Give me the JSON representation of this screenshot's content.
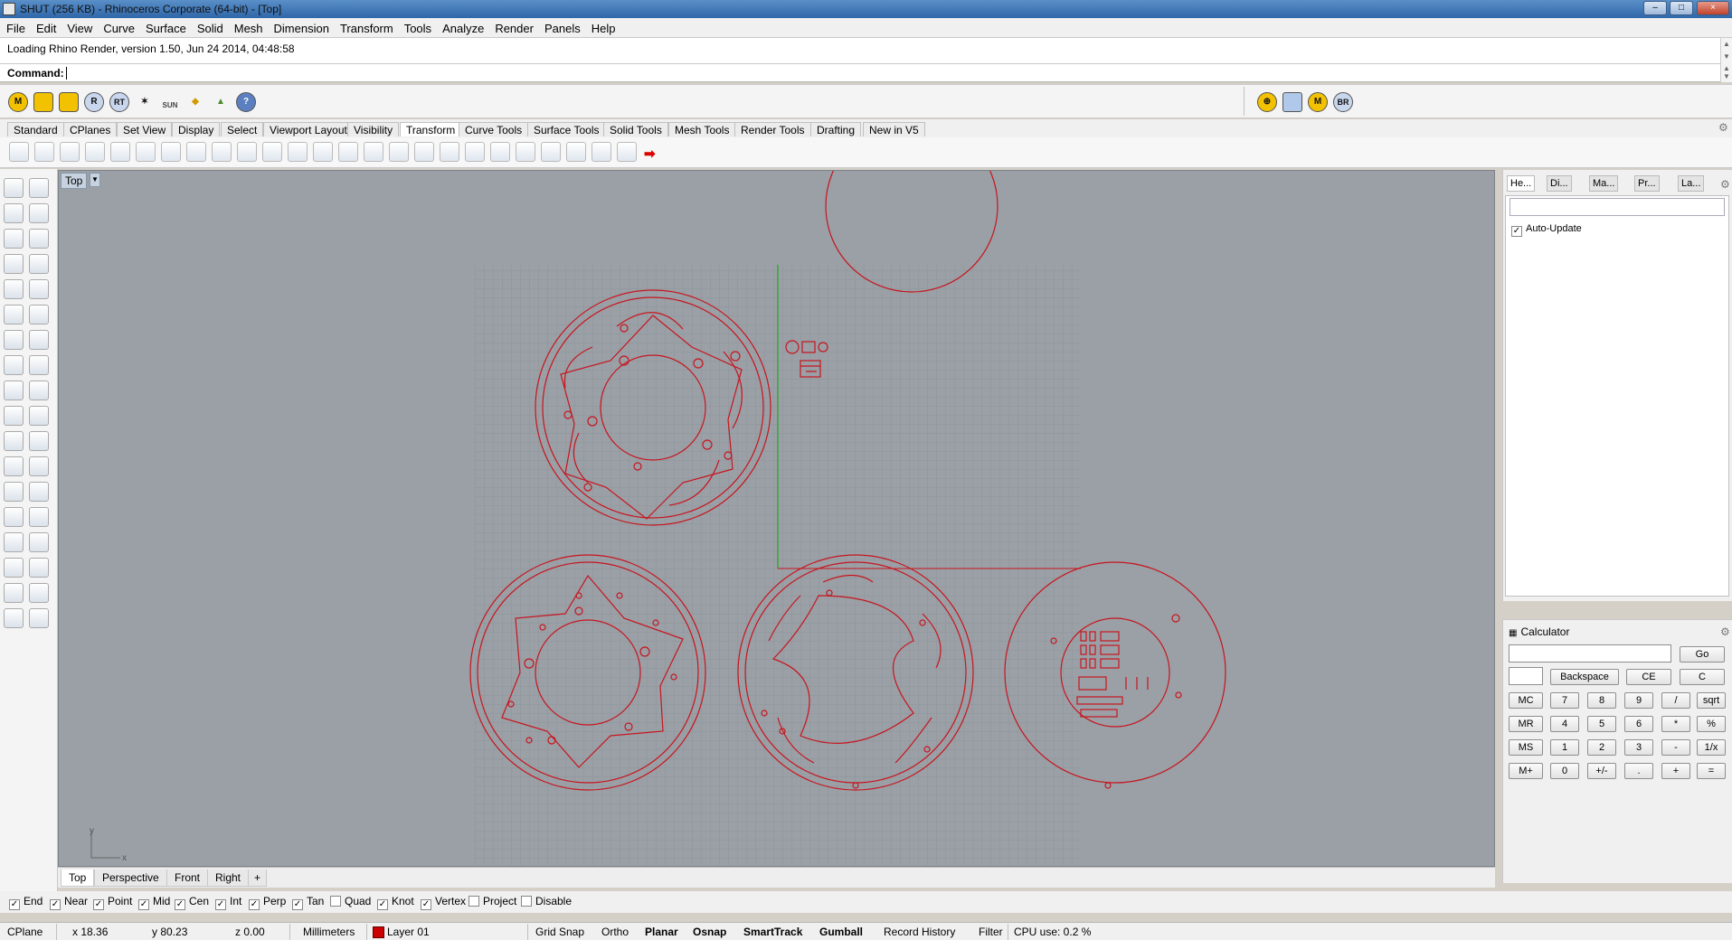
{
  "window": {
    "title": "SHUT (256 KB) - Rhinoceros Corporate (64-bit) - [Top]",
    "min": "–",
    "max": "□",
    "close": "×"
  },
  "menu": [
    "File",
    "Edit",
    "View",
    "Curve",
    "Surface",
    "Solid",
    "Mesh",
    "Dimension",
    "Transform",
    "Tools",
    "Analyze",
    "Render",
    "Panels",
    "Help"
  ],
  "history": {
    "line": "Loading Rhino Render, version 1.50, Jun 24 2014, 04:48:58"
  },
  "command": {
    "label": "Command:",
    "value": ""
  },
  "std_toolbar": {
    "icons": [
      "M",
      "",
      "",
      "R",
      "RT",
      "",
      "SUN",
      "",
      "",
      "?"
    ],
    "right_icons": [
      "",
      "",
      "M",
      "BR"
    ]
  },
  "toolbar_tabs": [
    "Standard",
    "CPlanes",
    "Set View",
    "Display",
    "Select",
    "Viewport Layout",
    "Visibility",
    "Transform",
    "Curve Tools",
    "Surface Tools",
    "Solid Tools",
    "Mesh Tools",
    "Render Tools",
    "Drafting",
    "New in V5"
  ],
  "toolbar_tabs_active": "Transform",
  "viewport": {
    "label": "Top",
    "axis_x": "x",
    "axis_y": "y"
  },
  "viewport_tabs": [
    "Top",
    "Perspective",
    "Front",
    "Right"
  ],
  "viewport_tabs_add": "+",
  "osnaps": [
    {
      "label": "End",
      "checked": true
    },
    {
      "label": "Near",
      "checked": true
    },
    {
      "label": "Point",
      "checked": true
    },
    {
      "label": "Mid",
      "checked": true
    },
    {
      "label": "Cen",
      "checked": true
    },
    {
      "label": "Int",
      "checked": true
    },
    {
      "label": "Perp",
      "checked": true
    },
    {
      "label": "Tan",
      "checked": true
    },
    {
      "label": "Quad",
      "checked": false
    },
    {
      "label": "Knot",
      "checked": true
    },
    {
      "label": "Vertex",
      "checked": true
    },
    {
      "label": "Project",
      "checked": false
    },
    {
      "label": "Disable",
      "checked": false
    }
  ],
  "status": {
    "cplane": "CPlane",
    "x": "x 18.36",
    "y": "y 80.23",
    "z": "z 0.00",
    "units": "Millimeters",
    "layer": "Layer 01",
    "layer_color": "#cc0000",
    "grid_snap": "Grid Snap",
    "ortho": "Ortho",
    "planar": "Planar",
    "osnap": "Osnap",
    "smarttrack": "SmartTrack",
    "gumball": "Gumball",
    "record_history": "Record History",
    "filter": "Filter",
    "cpu": "CPU use: 0.2 %"
  },
  "right_panel": {
    "tabs": [
      "He...",
      "Di...",
      "Ma...",
      "Pr...",
      "La..."
    ],
    "auto_update": "Auto-Update"
  },
  "calculator": {
    "title": "Calculator",
    "go": "Go",
    "backspace": "Backspace",
    "ce": "CE",
    "c": "C",
    "rows": [
      [
        "MC",
        "7",
        "8",
        "9",
        "/",
        "sqrt"
      ],
      [
        "MR",
        "4",
        "5",
        "6",
        "*",
        "%"
      ],
      [
        "MS",
        "1",
        "2",
        "3",
        "-",
        "1/x"
      ],
      [
        "M+",
        "0",
        "+/-",
        ".",
        "+",
        "="
      ]
    ]
  },
  "colors": {
    "curve": "#c8141e",
    "grid": "#8f969c",
    "viewport_bg": "#9aa0a6",
    "y_axis": "#3aa53a"
  }
}
